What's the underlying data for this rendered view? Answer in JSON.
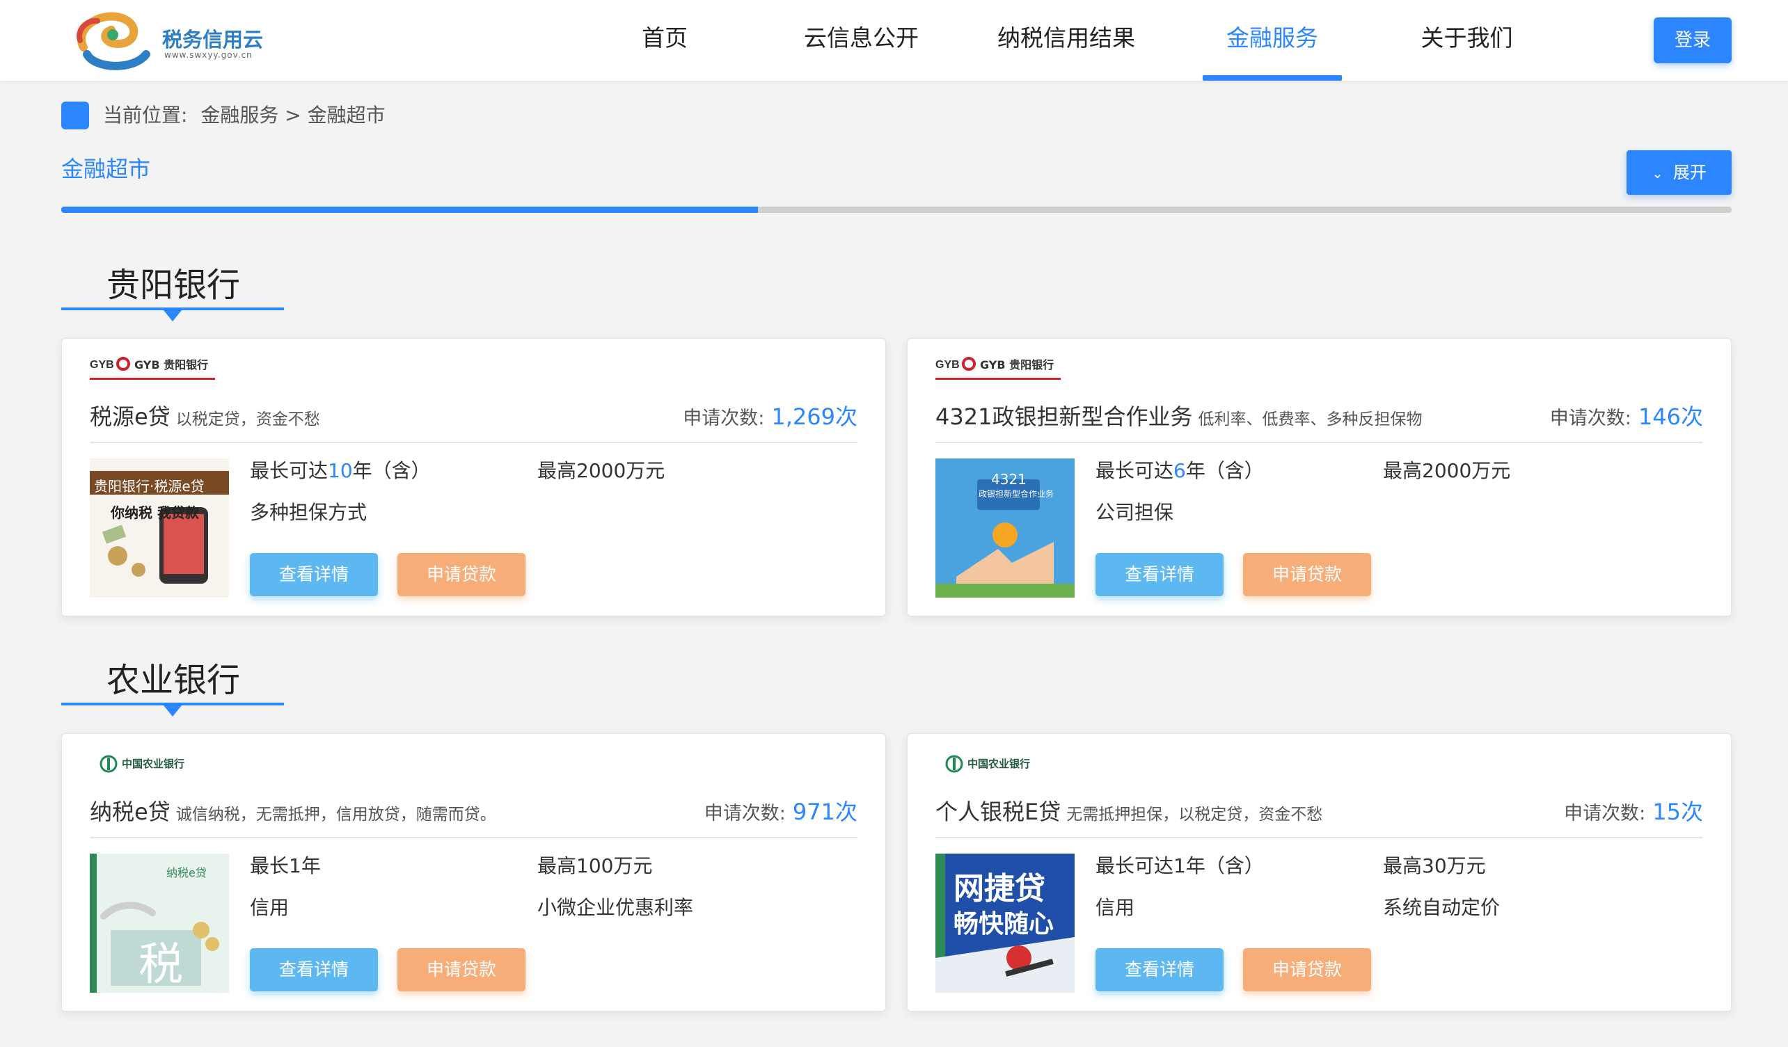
{
  "header": {
    "logo_text": "税务信用云",
    "logo_sub": "www.swxyy.gov.cn",
    "nav": [
      "首页",
      "云信息公开",
      "纳税信用结果",
      "金融服务",
      "关于我们"
    ],
    "active_nav": "金融服务",
    "login_label": "登录"
  },
  "breadcrumb": {
    "prefix": "当前位置:",
    "path": "金融服务 > 金融超市"
  },
  "section": {
    "tab_label": "金融超市",
    "expand_label": "展开",
    "progress": 0.417
  },
  "colors": {
    "accent": "#2b86ff",
    "detail_button": "#5db8f2",
    "apply_button": "#f7ad78"
  },
  "banks": [
    {
      "name": "贵阳银行",
      "logo_text": "GYB 贵阳银行",
      "cards": [
        {
          "product": "税源e贷",
          "slogan": "以税定贷，资金不愁",
          "count_label": "申请次数:",
          "count": "1,269次",
          "term_prefix": "最长可达",
          "term_highlight": "10",
          "term_suffix": "年（含）",
          "amount": "最高2000万元",
          "guarantee": "多种担保方式",
          "rate": "",
          "image_caption_1": "贵阳银行·税源e贷",
          "image_caption_2": "你纳税 我贷款",
          "detail_label": "查看详情",
          "apply_label": "申请贷款"
        },
        {
          "product": "4321政银担新型合作业务",
          "slogan": "低利率、低费率、多种反担保物",
          "count_label": "申请次数:",
          "count": "146次",
          "term_prefix": "最长可达",
          "term_highlight": "6",
          "term_suffix": "年（含）",
          "amount": "最高2000万元",
          "guarantee": "公司担保",
          "rate": "",
          "image_caption_1": "4321",
          "image_caption_2": "政银担新型合作业务",
          "detail_label": "查看详情",
          "apply_label": "申请贷款"
        }
      ]
    },
    {
      "name": "农业银行",
      "logo_text": "中国农业银行",
      "cards": [
        {
          "product": "纳税e贷",
          "slogan": "诚信纳税，无需抵押，信用放贷，随需而贷。",
          "count_label": "申请次数:",
          "count": "971次",
          "term_prefix": "最长1年",
          "term_highlight": "",
          "term_suffix": "",
          "amount": "最高100万元",
          "guarantee": "信用",
          "rate": "小微企业优惠利率",
          "image_caption_1": "纳税e贷",
          "image_caption_2": "税",
          "detail_label": "查看详情",
          "apply_label": "申请贷款"
        },
        {
          "product": "个人银税E贷",
          "slogan": "无需抵押担保，以税定贷，资金不愁",
          "count_label": "申请次数:",
          "count": "15次",
          "term_prefix": "最长可达1年（含）",
          "term_highlight": "",
          "term_suffix": "",
          "amount": "最高30万元",
          "guarantee": "信用",
          "rate": "系统自动定价",
          "image_caption_1": "网捷贷",
          "image_caption_2": "畅快随心",
          "detail_label": "查看详情",
          "apply_label": "申请贷款"
        }
      ]
    }
  ]
}
